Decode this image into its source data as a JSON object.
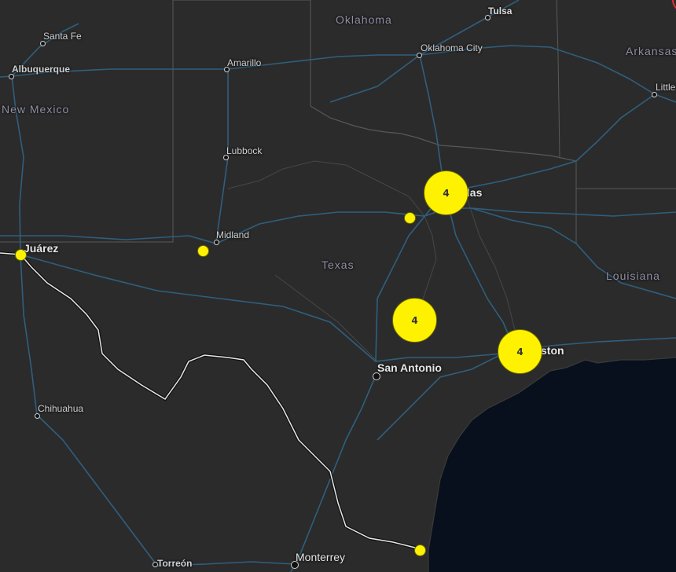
{
  "map": {
    "colors": {
      "land": "#2b2b2b",
      "water": "#07101c",
      "road": "#2f5f7e",
      "border": "#ffffff",
      "marker": "#fff200"
    },
    "states": [
      {
        "id": "oklahoma",
        "name": "Oklahoma"
      },
      {
        "id": "arkansas",
        "name": "Arkansas"
      },
      {
        "id": "new-mexico",
        "name": "New Mexico"
      },
      {
        "id": "texas",
        "name": "Texas"
      },
      {
        "id": "louisiana",
        "name": "Louisiana"
      }
    ],
    "cities": [
      {
        "id": "tulsa",
        "name": "Tulsa"
      },
      {
        "id": "oklahoma-city",
        "name": "Oklahoma City"
      },
      {
        "id": "little-rock",
        "name": "Little"
      },
      {
        "id": "santa-fe",
        "name": "Santa Fe"
      },
      {
        "id": "albuquerque",
        "name": "Albuquerque"
      },
      {
        "id": "amarillo",
        "name": "Amarillo"
      },
      {
        "id": "lubbock",
        "name": "Lubbock"
      },
      {
        "id": "dallas",
        "name": "llas"
      },
      {
        "id": "midland",
        "name": "Midland"
      },
      {
        "id": "juarez",
        "name": "Juárez"
      },
      {
        "id": "san-antonio",
        "name": "San Antonio"
      },
      {
        "id": "houston",
        "name": "ston"
      },
      {
        "id": "chihuahua",
        "name": "Chihuahua"
      },
      {
        "id": "monterrey",
        "name": "Monterrey"
      },
      {
        "id": "torreon",
        "name": "Torreón"
      }
    ],
    "clusters": [
      {
        "id": "dallas",
        "count": "4"
      },
      {
        "id": "central",
        "count": "4"
      },
      {
        "id": "houston",
        "count": "4"
      }
    ]
  }
}
